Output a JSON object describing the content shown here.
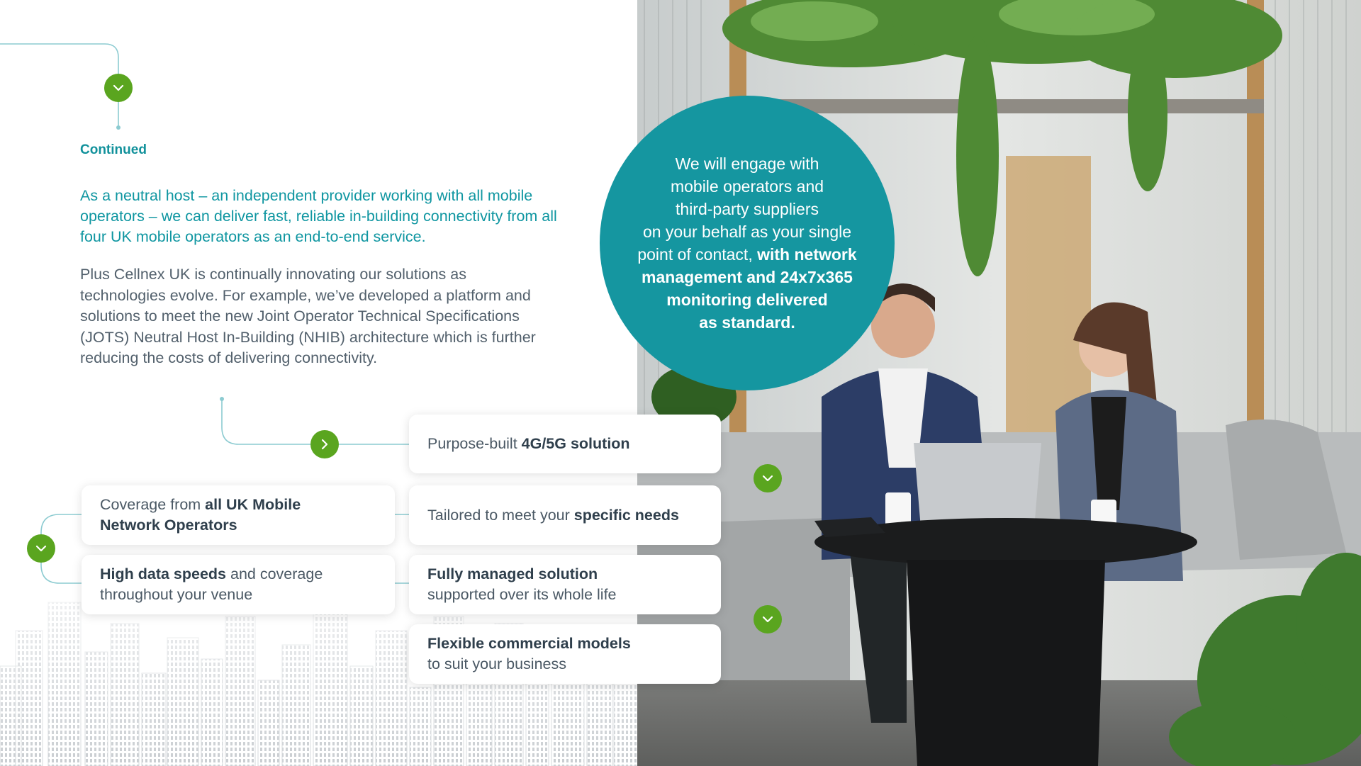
{
  "section": {
    "continued_label": "Continued"
  },
  "intro": {
    "lead": "As a neutral host – an independent provider working with all mobile operators – we can deliver fast, reliable in-building connectivity from all four UK mobile operators as an end-to-end service.",
    "body_line_1": "Plus Cellnex UK is continually innovating our solutions as",
    "body_line_2": "technologies evolve. For example, we’ve developed a platform and",
    "body_line_3": "solutions to meet the new Joint Operator Technical Specifications",
    "body_line_4": "(JOTS) Neutral Host In-Building (NHIB) architecture which is further",
    "body_line_5": "reducing the costs of delivering connectivity."
  },
  "quote": {
    "line_1": "We will engage with",
    "line_2": "mobile operators and",
    "line_3": "third-party suppliers",
    "line_4": "on your behalf as your single",
    "line_5_regular": "point of contact, ",
    "line_5_bold": "with network",
    "line_6": "management and 24x7x365",
    "line_7": "monitoring delivered",
    "line_8": "as standard."
  },
  "features": {
    "purpose_built": {
      "regular": "Purpose-built ",
      "bold": "4G/5G solution"
    },
    "coverage": {
      "regular": "Coverage from ",
      "bold_1": "all UK Mobile",
      "bold_2": "Network Operators"
    },
    "tailored": {
      "regular": "Tailored to meet your ",
      "bold": "specific needs"
    },
    "high_data": {
      "bold": "High data speeds",
      "regular_1": " and coverage",
      "regular_2": "throughout your venue"
    },
    "fully_managed": {
      "bold": "Fully managed solution",
      "regular": "supported over its whole life"
    },
    "flexible": {
      "bold": "Flexible commercial models",
      "regular": "to suit your business"
    }
  },
  "colors": {
    "teal": "#1596a0",
    "green": "#5aa51f",
    "line": "#7fc4cb",
    "text": "#52606c"
  },
  "icons": {
    "chevron_down": "chevron-down-icon",
    "chevron_right": "chevron-right-icon"
  }
}
